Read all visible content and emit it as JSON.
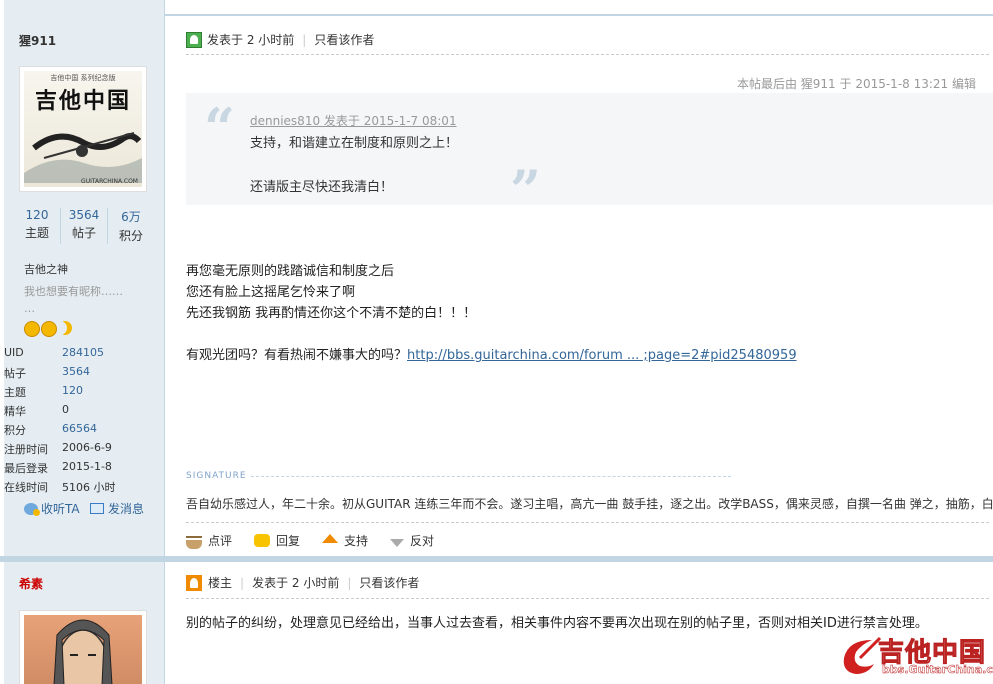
{
  "post1": {
    "author_name": "猩911",
    "stats": [
      {
        "num": "120",
        "label": "主题"
      },
      {
        "num": "3564",
        "label": "帖子"
      },
      {
        "num": "6万",
        "label": "积分"
      }
    ],
    "rank_title": "吉他之神",
    "custom_title": "我也想要有昵称……",
    "custom_title_more": "…",
    "info": [
      {
        "k": "UID",
        "v": "284105"
      },
      {
        "k": "帖子",
        "v": "3564"
      },
      {
        "k": "主题",
        "v": "120"
      },
      {
        "k": "精华",
        "v": "0"
      },
      {
        "k": "积分",
        "v": "66564"
      },
      {
        "k": "注册时间",
        "v": "2006-6-9"
      },
      {
        "k": "最后登录",
        "v": "2015-1-8"
      },
      {
        "k": "在线时间",
        "v": "5106 小时"
      }
    ],
    "follow_label": "收听TA",
    "message_label": "发消息",
    "posted_label": "发表于 2 小时前",
    "only_author_label": "只看该作者",
    "edit_note": "本帖最后由 猩911 于 2015-1-8 13:21 编辑",
    "quote": {
      "header": "dennies810 发表于 2015-1-7 08:01",
      "line1": "支持，和谐建立在制度和原则之上！",
      "line2": "还请版主尽快还我清白！"
    },
    "body": [
      "再您毫无原则的践踏诚信和制度之后",
      "您还有脸上这摇尾乞怜来了啊",
      "先还我钢筋 我再酌情还你这个不清不楚的白！！！"
    ],
    "body_link_prefix": "有观光团吗？有看热闹不嫌事大的吗？",
    "body_link": "http://bbs.guitarchina.com/forum ... ;page=2#pid25480959",
    "signature_label": "SIGNATURE",
    "signature_text": "吾自幼乐感过人，年二十余。初从GUITAR  连练三年而不会。遂习主唱，高亢一曲 鼓手挂，逐之出。改学BASS，偶来灵感，自撰一名曲 弹之，抽筋，白",
    "actions": [
      "点评",
      "回复",
      "支持",
      "反对"
    ]
  },
  "post2": {
    "author_name": "希素",
    "owner_label": "楼主",
    "posted_label": "发表于 2 小时前",
    "only_author_label": "只看该作者",
    "body": "别的帖子的纠纷，处理意见已经给出，当事人过去查看，相关事件内容不要再次出现在别的帖子里，否则对相关ID进行禁言处理。"
  },
  "avatar_text": {
    "top": "吉他中国 系列纪念版",
    "main": "吉他中国",
    "bottom": "GUITARCHINA.COM"
  },
  "watermark": {
    "main": "吉他中国",
    "sub": "bbs.GuitarChina.com"
  },
  "colors": {
    "sidebar_bg": "#E5EDF2",
    "link": "#336699",
    "accent_red": "#CC0000"
  }
}
